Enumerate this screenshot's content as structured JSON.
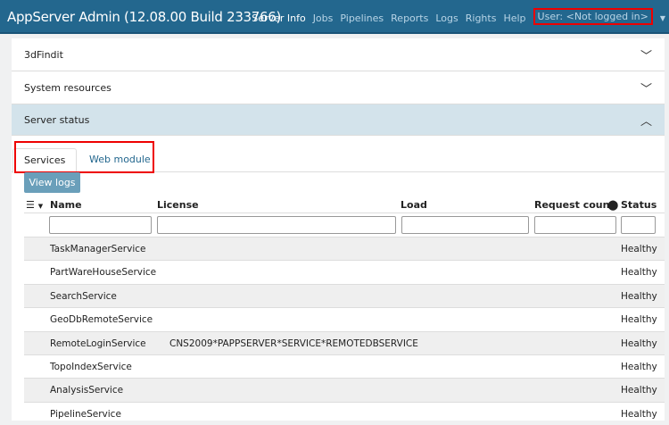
{
  "header": {
    "title": "AppServer Admin (12.08.00 Build 233766)",
    "nav": [
      "Server Info",
      "Jobs",
      "Pipelines",
      "Reports",
      "Logs",
      "Rights",
      "Help"
    ],
    "user": "User: <Not logged in>"
  },
  "panels": [
    "3dFindit",
    "System resources",
    "Server status"
  ],
  "tabs": [
    "Services",
    "Web module"
  ],
  "view_logs": "View logs",
  "columns": [
    "Name",
    "License",
    "Load",
    "Request count",
    "Status"
  ],
  "rows": [
    {
      "name": "TaskManagerService",
      "license": "",
      "status": "Healthy"
    },
    {
      "name": "PartWareHouseService",
      "license": "",
      "status": "Healthy"
    },
    {
      "name": "SearchService",
      "license": "",
      "status": "Healthy"
    },
    {
      "name": "GeoDbRemoteService",
      "license": "",
      "status": "Healthy"
    },
    {
      "name": "RemoteLoginService",
      "license": "CNS2009*PAPPSERVER*SERVICE*REMOTEDBSERVICE",
      "status": "Healthy"
    },
    {
      "name": "TopoIndexService",
      "license": "",
      "status": "Healthy"
    },
    {
      "name": "AnalysisService",
      "license": "",
      "status": "Healthy"
    },
    {
      "name": "PipelineService",
      "license": "",
      "status": "Healthy"
    }
  ]
}
